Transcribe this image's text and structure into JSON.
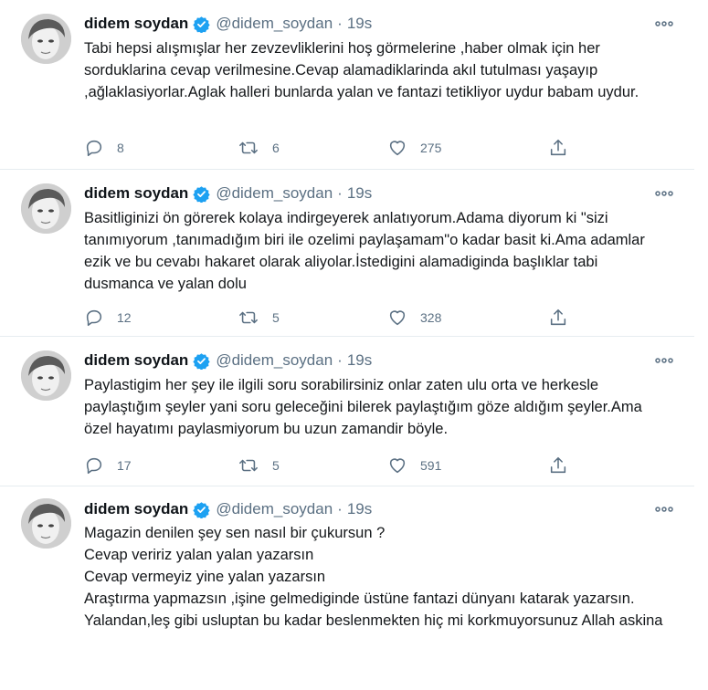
{
  "tweets": [
    {
      "name": "didem soydan",
      "handle": "@didem_soydan",
      "dot": "·",
      "time": "19s",
      "text": "Tabi hepsi alışmışlar her zevzevliklerini hoş görmelerine ,haber olmak için her sorduklarina cevap verilmesine.Cevap alamadiklarinda akıl tutulması yaşayıp ,ağlaklasiyorlar.Aglak halleri bunlarda yalan ve fantazi tetikliyor uydur babam uydur.",
      "replies": "8",
      "retweets": "6",
      "likes": "275"
    },
    {
      "name": "didem soydan",
      "handle": "@didem_soydan",
      "dot": "·",
      "time": "19s",
      "text": "Basitliginizi ön görerek kolaya indirgeyerek anlatıyorum.Adama diyorum ki \"sizi tanımıyorum ,tanımadığım biri ile ozelimi paylaşamam\"o kadar basit ki.Ama adamlar ezik ve bu cevabı hakaret olarak aliyolar.İstedigini alamadiginda  başlıklar tabi dusmanca ve yalan dolu",
      "replies": "12",
      "retweets": "5",
      "likes": "328"
    },
    {
      "name": "didem soydan",
      "handle": "@didem_soydan",
      "dot": "·",
      "time": "19s",
      "text": "Paylastigim her şey ile ilgili soru sorabilirsiniz onlar zaten ulu orta ve herkesle paylaştığım şeyler yani soru geleceğini bilerek paylaştığım göze aldığım şeyler.Ama özel hayatımı paylasmiyorum bu uzun zamandir böyle.",
      "replies": "17",
      "retweets": "5",
      "likes": "591"
    },
    {
      "name": "didem soydan",
      "handle": "@didem_soydan",
      "dot": "·",
      "time": "19s",
      "text": "Magazin denilen şey sen nasıl bir çukursun ?\nCevap veririz yalan yalan yazarsın\nCevap vermeyiz yine yalan yazarsın\nAraştırma yapmazsın ,işine gelmediginde üstüne fantazi dünyanı katarak yazarsın.\nYalandan,leş gibi usluptan bu kadar beslenmekten hiç mi korkmuyorsunuz Allah askina"
    }
  ],
  "icons": {
    "verified_color": "#1da1f2",
    "action_color": "#5b7083"
  }
}
